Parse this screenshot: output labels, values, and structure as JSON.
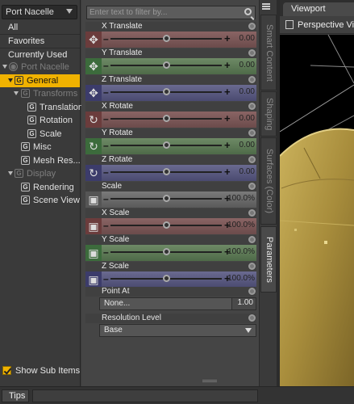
{
  "node_select": {
    "value": "Port Nacelle"
  },
  "filters": [
    {
      "label": "All"
    },
    {
      "label": "Favorites"
    },
    {
      "label": "Currently Used"
    }
  ],
  "tree": [
    {
      "label": "Port Nacelle",
      "indent": 0,
      "dim": true,
      "arrow": true,
      "type": "node"
    },
    {
      "label": "General",
      "indent": 1,
      "selected": true,
      "arrow": true
    },
    {
      "label": "Transforms",
      "indent": 2,
      "dim": true,
      "arrow": true
    },
    {
      "label": "Translation",
      "indent": 3
    },
    {
      "label": "Rotation",
      "indent": 3
    },
    {
      "label": "Scale",
      "indent": 3
    },
    {
      "label": "Misc",
      "indent": 2
    },
    {
      "label": "Mesh Res...",
      "indent": 2
    },
    {
      "label": "Display",
      "indent": 1,
      "dim": true,
      "arrow": true
    },
    {
      "label": "Rendering",
      "indent": 2
    },
    {
      "label": "Scene View",
      "indent": 2
    }
  ],
  "show_sub_items": {
    "label": "Show Sub Items",
    "checked": true
  },
  "filter_field": {
    "placeholder": "Enter text to filter by..."
  },
  "properties": [
    {
      "label": "X Translate",
      "value": "0.00",
      "color": "red",
      "icon": "move-icon",
      "knob": 0.5
    },
    {
      "label": "Y Translate",
      "value": "0.00",
      "color": "green",
      "icon": "move-icon",
      "knob": 0.5
    },
    {
      "label": "Z Translate",
      "value": "0.00",
      "color": "blue",
      "icon": "move-icon",
      "knob": 0.5
    },
    {
      "label": "X Rotate",
      "value": "0.00",
      "color": "red",
      "icon": "rotate-icon",
      "knob": 0.5
    },
    {
      "label": "Y Rotate",
      "value": "0.00",
      "color": "green",
      "icon": "rotate-icon",
      "knob": 0.5
    },
    {
      "label": "Z Rotate",
      "value": "0.00",
      "color": "blue",
      "icon": "rotate-icon",
      "knob": 0.5
    },
    {
      "label": "Scale",
      "value": "100.0%",
      "color": "gray",
      "icon": "scale-icon",
      "knob": 0.5
    },
    {
      "label": "X Scale",
      "value": "100.0%",
      "color": "red",
      "icon": "scale-icon",
      "knob": 0.5
    },
    {
      "label": "Y Scale",
      "value": "100.0%",
      "color": "green",
      "icon": "scale-icon",
      "knob": 0.5
    },
    {
      "label": "Z Scale",
      "value": "100.0%",
      "color": "blue",
      "icon": "scale-icon",
      "knob": 0.5
    }
  ],
  "point_at": {
    "label": "Point At",
    "value": "None...",
    "number": "1.00"
  },
  "resolution": {
    "label": "Resolution Level",
    "value": "Base"
  },
  "side_tabs": [
    {
      "label": "Smart Content",
      "active": false
    },
    {
      "label": "Shaping",
      "active": false
    },
    {
      "label": "Surfaces (Color)",
      "active": false
    },
    {
      "label": "Parameters",
      "active": true
    }
  ],
  "viewport": {
    "tab": "Viewport",
    "camera": "Perspective View"
  },
  "bottom": {
    "tips": "Tips"
  },
  "colors": {
    "accent": "#f0b200",
    "x_axis": "#8a6464",
    "y_axis": "#6e8a66",
    "z_axis": "#6a6a90"
  }
}
